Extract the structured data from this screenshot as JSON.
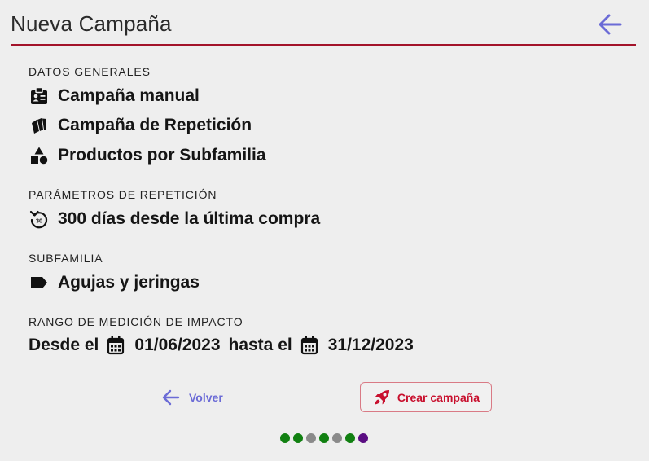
{
  "header": {
    "title": "Nueva Campaña",
    "back_icon": "arrow-left-icon"
  },
  "datos_generales": {
    "label": "DATOS GENERALES",
    "items": [
      {
        "icon": "id-badge-icon",
        "text": "Campaña manual"
      },
      {
        "icon": "tags-icon",
        "text": "Campaña de Repetición"
      },
      {
        "icon": "shapes-icon",
        "text": "Productos por Subfamilia"
      }
    ]
  },
  "parametros": {
    "label": "PARÁMETROS DE REPETICIÓN",
    "icon": "replay-30-icon",
    "text": "300 días desde la última compra"
  },
  "subfamilia": {
    "label": "SUBFAMILIA",
    "icon": "label-tag-icon",
    "text": "Agujas y jeringas"
  },
  "rango": {
    "label": "RANGO DE MEDICIÓN DE IMPACTO",
    "desde_label": "Desde el",
    "desde_value": "01/06/2023",
    "hasta_label": "hasta el",
    "hasta_value": "31/12/2023"
  },
  "actions": {
    "volver_label": "Volver",
    "crear_label": "Crear campaña"
  },
  "stepper": {
    "dots": [
      {
        "color": "#118011"
      },
      {
        "color": "#118011"
      },
      {
        "color": "#8a8a8a"
      },
      {
        "color": "#118011"
      },
      {
        "color": "#8a8a8a"
      },
      {
        "color": "#118011"
      },
      {
        "color": "#5a0d82"
      }
    ]
  },
  "colors": {
    "accent": "#6b6bd6",
    "brand": "#c8102e",
    "divider": "#a3132a"
  }
}
